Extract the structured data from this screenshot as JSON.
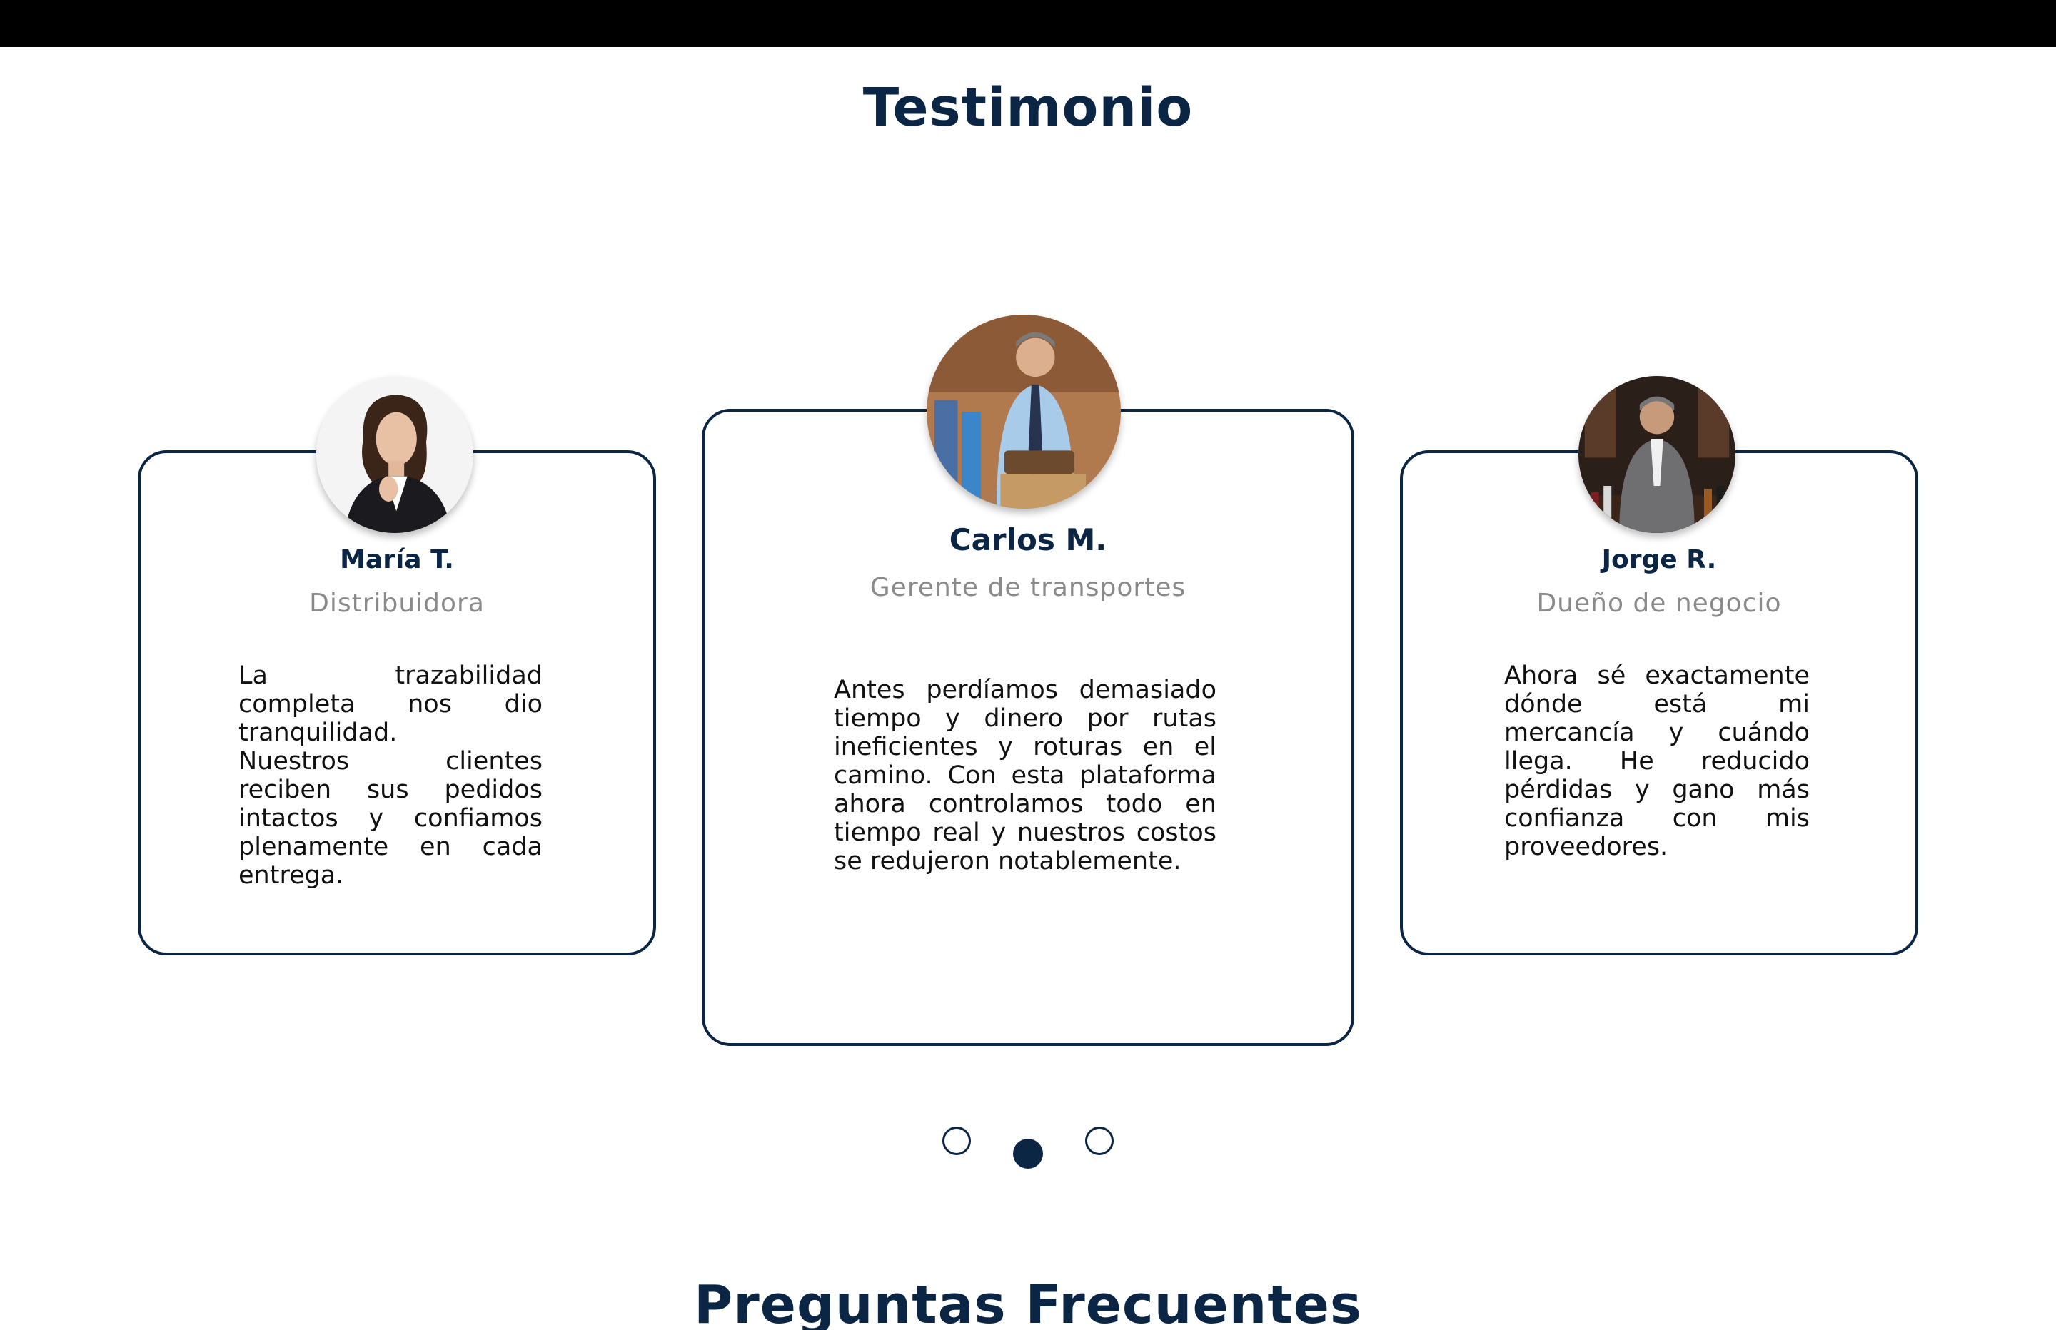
{
  "testimonials_section": {
    "title": "Testimonio",
    "cards": [
      {
        "name": "María T.",
        "role": "Distribuidora",
        "quote": "La trazabilidad completa nos dio tranquilidad.\nNuestros clientes reciben sus pedidos intactos y confiamos plenamente en cada entrega.",
        "avatar_icon": "woman-portrait"
      },
      {
        "name": "Carlos M.",
        "role": "Gerente de transportes",
        "quote": "Antes perdíamos demasiado tiempo y dinero por rutas ineficientes y roturas en el camino. Con esta plataforma ahora controlamos todo en tiempo real y nuestros costos se redujeron notablemente.",
        "avatar_icon": "man-warehouse-portrait"
      },
      {
        "name": "Jorge R.",
        "role": "Dueño de negocio",
        "quote": "Ahora sé exactamente dónde está mi mercancía y cuándo llega. He reducido pérdidas y gano más confianza con mis proveedores.",
        "avatar_icon": "man-bar-portrait"
      }
    ],
    "carousel": {
      "dots": 3,
      "active_index": 1
    }
  },
  "faq_section": {
    "title": "Preguntas Frecuentes"
  },
  "colors": {
    "primary": "#0b2545",
    "role_gray": "#8a8a8a",
    "top_bar": "#000000",
    "background": "#ffffff"
  }
}
